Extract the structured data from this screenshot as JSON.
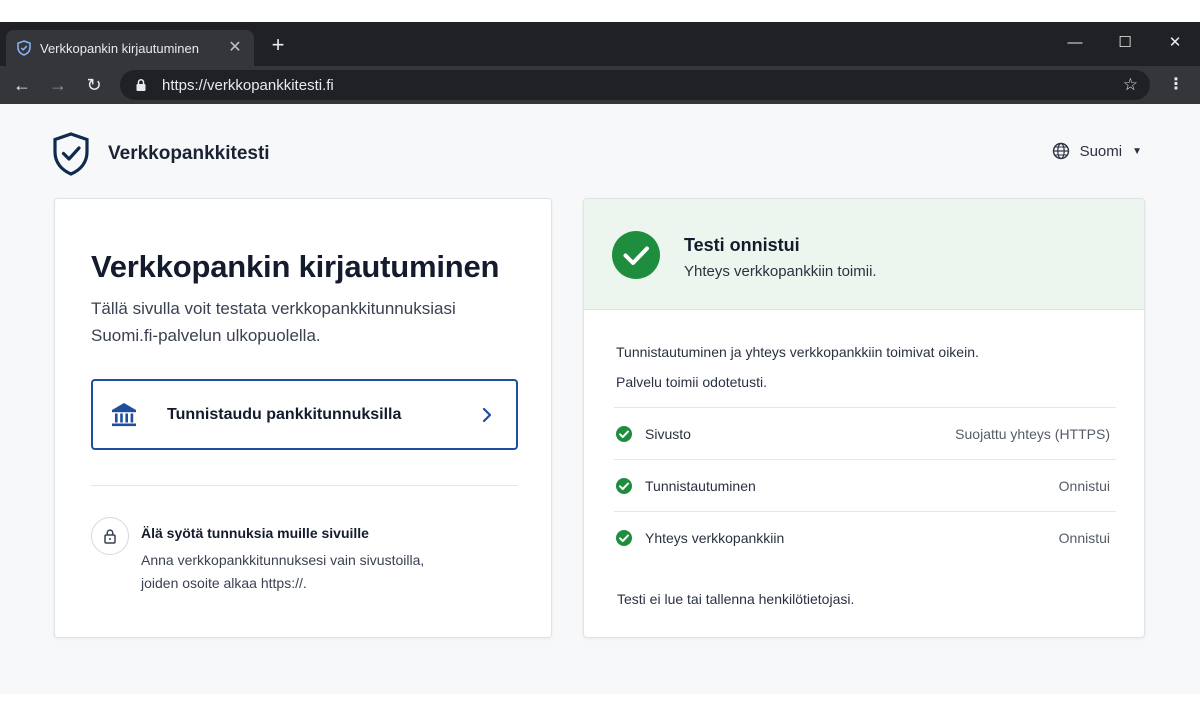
{
  "browser": {
    "tab_title": "Verkkopankin kirjautuminen",
    "tab_close": "✕",
    "new_tab": "+",
    "url": "https://verkkopankkitesti.fi",
    "window_minimize": "—",
    "window_maximize": "☐",
    "window_close": "✕",
    "back_icon": "←",
    "forward_icon": "→",
    "reload_icon": "↻",
    "star_icon": "☆",
    "menu_icon": "⋮"
  },
  "header": {
    "brand": "Verkkopankkitesti",
    "language": "Suomi",
    "language_caret": "▼"
  },
  "login_card": {
    "title": "Verkkopankin kirjautuminen",
    "lead": "Tällä sivulla voit testata verkkopankkitunnuksiasi Suomi.fi-palvelun ulkopuolella.",
    "cta_label": "Tunnistaudu pankkitunnuksilla",
    "notice_title": "Älä syötä tunnuksia muille sivuille",
    "notice_text": "Anna verkkopankkitunnuksesi vain sivustoilla, joiden osoite alkaa https://."
  },
  "result_card": {
    "status_title": "Testi onnistui",
    "status_subtitle": "Yhteys verkkopankkiin toimii.",
    "paragraph_1": "Tunnistautuminen ja yhteys verkkopankkiin toimivat oikein.",
    "paragraph_2": "Palvelu toimii odotetusti.",
    "checks": [
      {
        "name": "Sivusto",
        "value": "Suojattu yhteys (HTTPS)"
      },
      {
        "name": "Tunnistautuminen",
        "value": "Onnistui"
      },
      {
        "name": "Yhteys verkkopankkiin",
        "value": "Onnistui"
      }
    ],
    "footnote": "Testi ei lue tai tallenna henkilötietojasi."
  },
  "colors": {
    "accent_blue": "#1f4f9c",
    "brand_navy": "#0f2a4d",
    "success_green": "#1e8e3e",
    "success_bg": "#ecf6ef",
    "browser_dark": "#202124"
  }
}
